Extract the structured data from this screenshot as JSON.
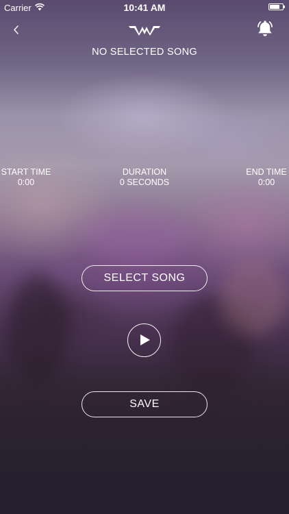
{
  "status_bar": {
    "carrier": "Carrier",
    "time": "10:41 AM",
    "battery_level": 0.8
  },
  "nav": {
    "back_icon": "chevron-left-icon",
    "logo_icon": "waveform-logo-icon",
    "alarm_icon": "bell-icon"
  },
  "song": {
    "title": "NO SELECTED SONG"
  },
  "timing": {
    "start_label": "START TIME",
    "start_value": "0:00",
    "duration_label": "DURATION",
    "duration_value": "0 SECONDS",
    "end_label": "END TIME",
    "end_value": "0:00"
  },
  "actions": {
    "select_song_label": "SELECT SONG",
    "play_icon": "play-icon",
    "save_label": "SAVE"
  },
  "colors": {
    "text": "#ffffff",
    "background_dark": "#262130",
    "background_purple": "#6a4c77"
  }
}
